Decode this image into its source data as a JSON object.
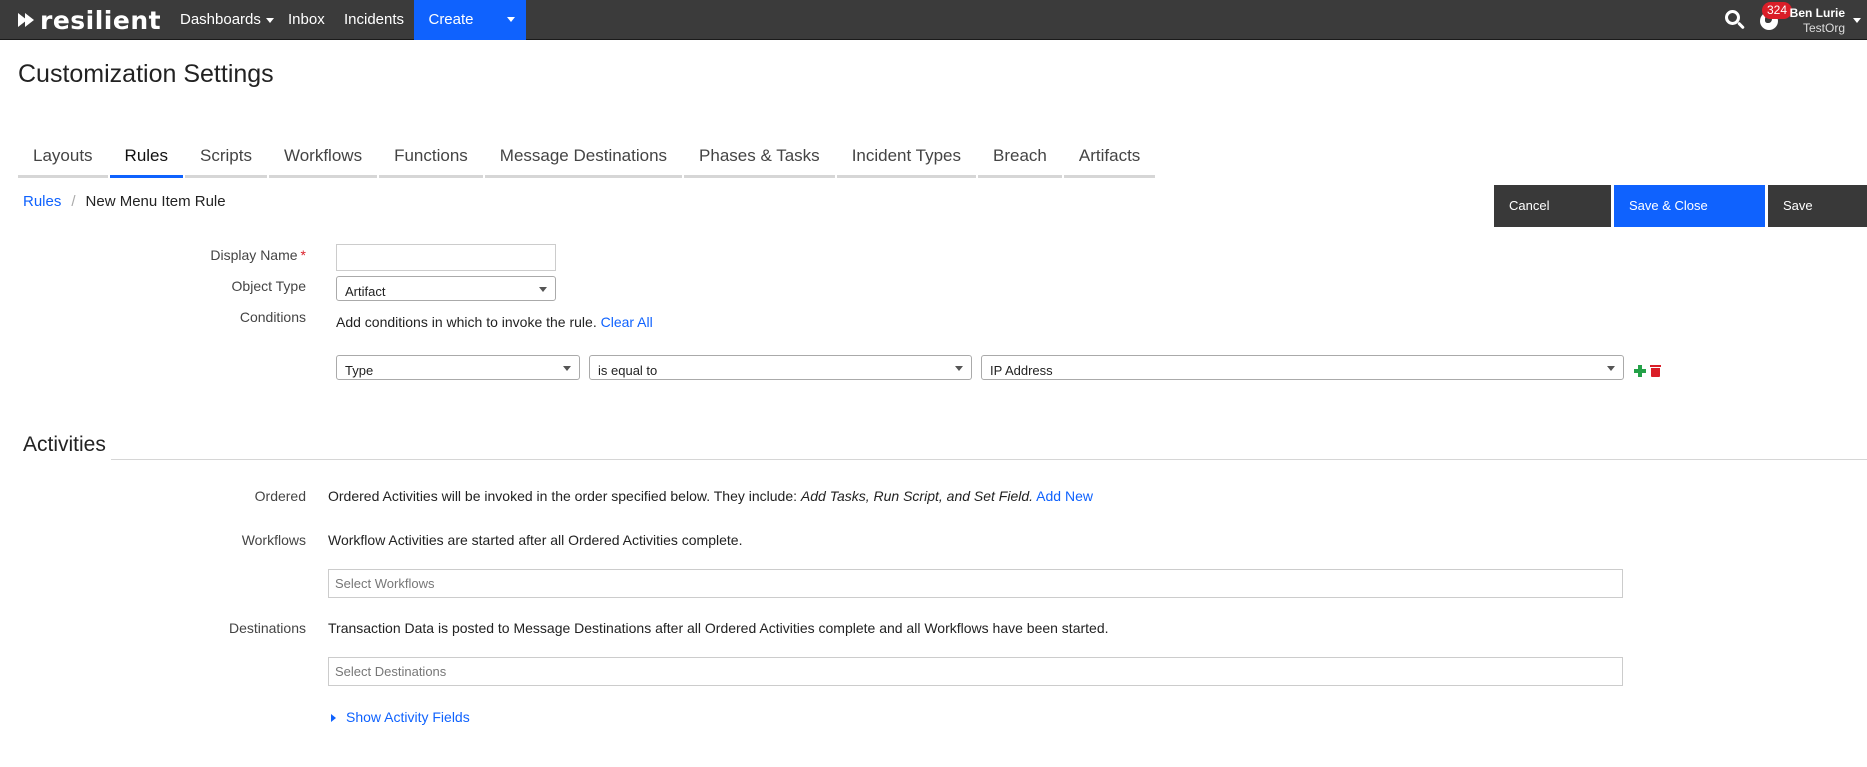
{
  "brand": {
    "name": "resilient"
  },
  "nav": {
    "dashboards": "Dashboards",
    "inbox": "Inbox",
    "incidents": "Incidents",
    "create": "Create"
  },
  "user": {
    "notifications": "324",
    "name": "Ben Lurie",
    "org": "TestOrg"
  },
  "page": {
    "title": "Customization Settings"
  },
  "tabs": [
    {
      "label": "Layouts"
    },
    {
      "label": "Rules",
      "active": true
    },
    {
      "label": "Scripts"
    },
    {
      "label": "Workflows"
    },
    {
      "label": "Functions"
    },
    {
      "label": "Message Destinations"
    },
    {
      "label": "Phases & Tasks"
    },
    {
      "label": "Incident Types"
    },
    {
      "label": "Breach"
    },
    {
      "label": "Artifacts"
    }
  ],
  "breadcrumb": {
    "root": "Rules",
    "separator": "/",
    "current": "New Menu Item Rule"
  },
  "actions": {
    "cancel": "Cancel",
    "save_close": "Save & Close",
    "save": "Save"
  },
  "form": {
    "display_name_label": "Display Name",
    "required_mark": "*",
    "display_name_value": "",
    "object_type_label": "Object Type",
    "object_type_value": "Artifact",
    "conditions_label": "Conditions",
    "conditions_text": "Add conditions in which to invoke the rule.",
    "clear_all": "Clear All",
    "condition": {
      "field": "Type",
      "operator": "is equal to",
      "value": "IP Address"
    }
  },
  "activities": {
    "title": "Activities",
    "ordered_label": "Ordered",
    "ordered_text": "Ordered Activities will be invoked in the order specified below. They include: ",
    "ordered_italic": "Add Tasks, Run Script, and Set Field.",
    "add_new": "Add New",
    "workflows_label": "Workflows",
    "workflows_text": "Workflow Activities are started after all Ordered Activities complete.",
    "workflows_placeholder": "Select Workflows",
    "destinations_label": "Destinations",
    "destinations_text": "Transaction Data is posted to Message Destinations after all Ordered Activities complete and all Workflows have been started.",
    "destinations_placeholder": "Select Destinations",
    "show_fields": "Show Activity Fields"
  }
}
